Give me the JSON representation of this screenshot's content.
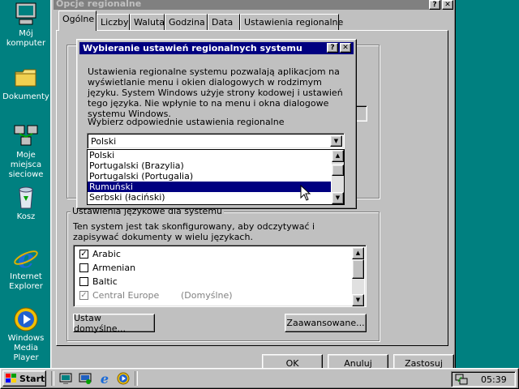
{
  "desktop": {
    "icons": [
      {
        "name": "computer-icon",
        "label": "Mój komputer"
      },
      {
        "name": "folder-icon",
        "label": "Dokumenty"
      },
      {
        "name": "network-icon",
        "label": "Moje miejsca sieciowe"
      },
      {
        "name": "recycle-bin-icon",
        "label": "Kosz"
      },
      {
        "name": "internet-explorer-icon",
        "label": "Internet Explorer"
      },
      {
        "name": "media-player-icon",
        "label": "Windows Media Player"
      }
    ]
  },
  "main_window": {
    "title": "Opcje regionalne",
    "help_btn": "?",
    "close_btn": "✕",
    "tabs": [
      "Ogólne",
      "Liczby",
      "Waluta",
      "Godzina",
      "Data",
      "Ustawienia regionalne"
    ],
    "language_group": {
      "label": "Ustawienia językowe dla systemu",
      "description": "Ten system jest tak skonfigurowany, aby odczytywać i zapisywać dokumenty w wielu językach.",
      "items": [
        {
          "label": "Arabic",
          "checked": true,
          "note": ""
        },
        {
          "label": "Armenian",
          "checked": false,
          "note": ""
        },
        {
          "label": "Baltic",
          "checked": false,
          "note": ""
        },
        {
          "label": "Central Europe",
          "checked": true,
          "note": "(Domyślne)"
        }
      ],
      "default_button": "Ustaw domyślne...",
      "advanced_button": "Zaawansowane..."
    },
    "ok": "OK",
    "cancel": "Anuluj",
    "apply": "Zastosuj"
  },
  "dialog": {
    "title": "Wybieranie ustawień regionalnych systemu",
    "help_btn": "?",
    "close_btn": "✕",
    "description": "Ustawienia regionalne systemu pozwalają aplikacjom na wyświetlanie menu i okien dialogowych w rodzimym języku. System Windows użyje strony kodowej i ustawień tego języka. Nie wpłynie to na menu i okna dialogowe systemu Windows.",
    "prompt": "Wybierz odpowiednie ustawienia regionalne",
    "selected": "Polski",
    "options": [
      "Polski",
      "Portugalski (Brazylia)",
      "Portugalski (Portugalia)",
      "Rumuński",
      "Serbski (łaciński)"
    ],
    "highlighted_index": 3
  },
  "taskbar": {
    "start": "Start",
    "quick_launch": [
      "show-desktop-icon",
      "explorer-icon",
      "ie-icon",
      "media-player-icon"
    ],
    "clock": "05:39"
  },
  "colors": {
    "desktop": "#008080",
    "face": "#c0c0c0",
    "title_active": "#000080",
    "title_inactive": "#808080",
    "highlight": "#000080"
  }
}
